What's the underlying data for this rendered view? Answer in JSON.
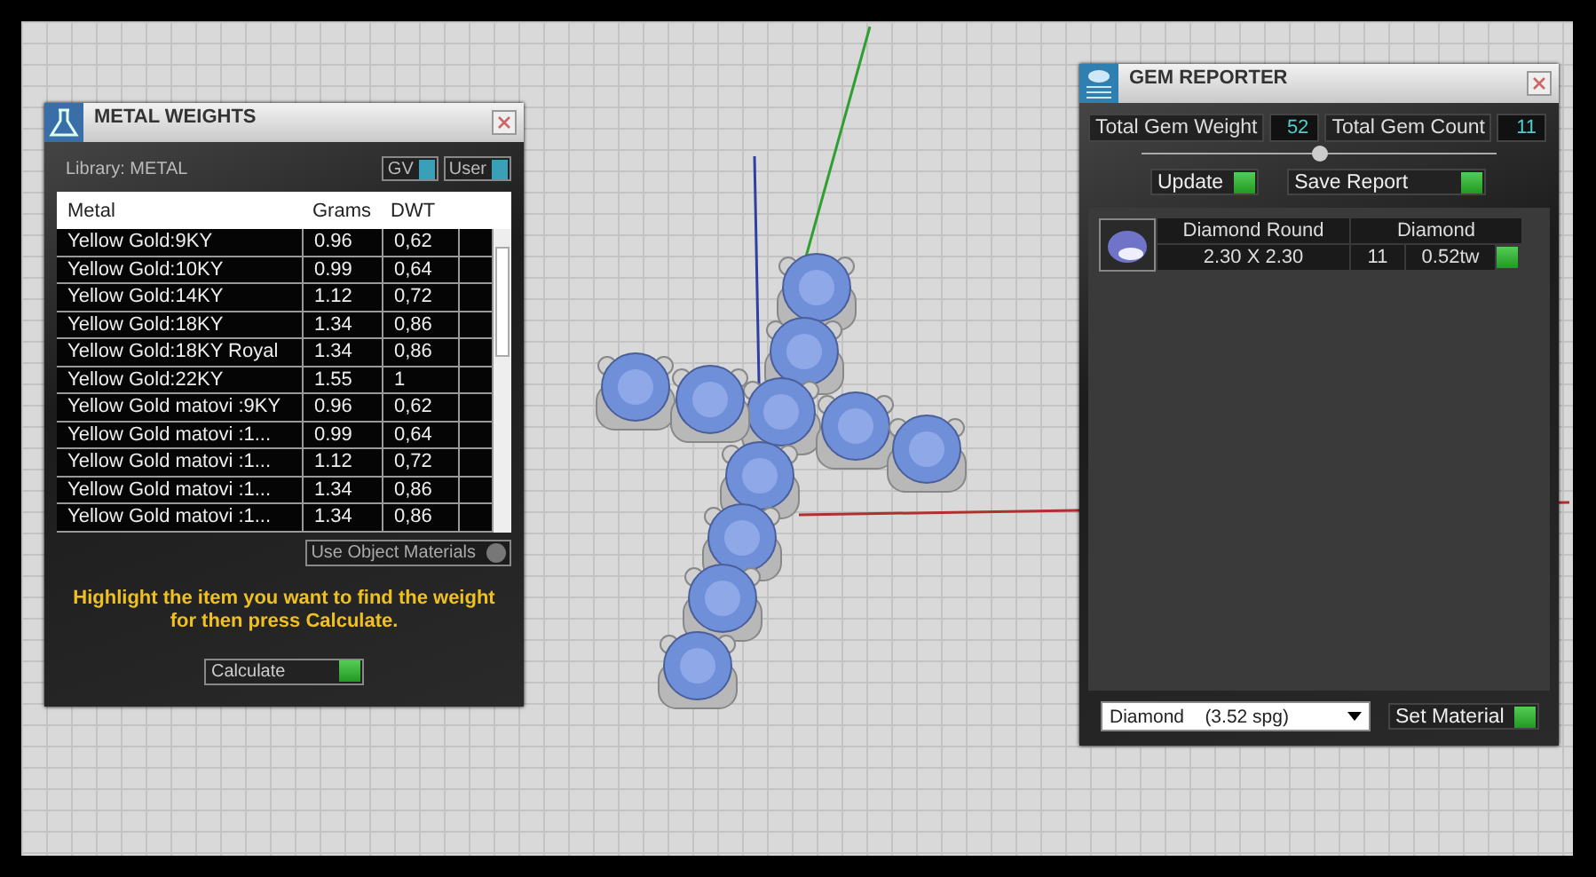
{
  "metal_weights": {
    "title": "METAL WEIGHTS",
    "library_label": "Library: METAL",
    "toggles": [
      {
        "label": "GV"
      },
      {
        "label": "User"
      }
    ],
    "columns": [
      "Metal",
      "Grams",
      "DWT"
    ],
    "rows": [
      {
        "metal": "Yellow Gold:9KY",
        "grams": "0.96",
        "dwt": "0,62"
      },
      {
        "metal": "Yellow Gold:10KY",
        "grams": "0.99",
        "dwt": "0,64"
      },
      {
        "metal": "Yellow Gold:14KY",
        "grams": "1.12",
        "dwt": "0,72"
      },
      {
        "metal": "Yellow Gold:18KY",
        "grams": "1.34",
        "dwt": "0,86"
      },
      {
        "metal": "Yellow Gold:18KY Royal",
        "grams": "1.34",
        "dwt": "0,86"
      },
      {
        "metal": "Yellow Gold:22KY",
        "grams": "1.55",
        "dwt": "1"
      },
      {
        "metal": "Yellow Gold matovi :9KY",
        "grams": "0.96",
        "dwt": "0,62"
      },
      {
        "metal": "Yellow Gold matovi :1...",
        "grams": "0.99",
        "dwt": "0,64"
      },
      {
        "metal": "Yellow Gold matovi :1...",
        "grams": "1.12",
        "dwt": "0,72"
      },
      {
        "metal": "Yellow Gold matovi :1...",
        "grams": "1.34",
        "dwt": "0,86"
      },
      {
        "metal": "Yellow Gold matovi :1...",
        "grams": "1.34",
        "dwt": "0,86"
      }
    ],
    "use_object_materials": "Use Object Materials",
    "hint": "Highlight the item you want to find the weight for then press Calculate.",
    "calculate": "Calculate"
  },
  "gem_reporter": {
    "title": "GEM REPORTER",
    "total_weight_label": "Total Gem Weight",
    "total_weight": "52",
    "total_count_label": "Total Gem Count",
    "total_count": "11",
    "update": "Update",
    "save_report": "Save Report",
    "gems": [
      {
        "shape": "Diamond Round",
        "size": "2.30 X 2.30",
        "material": "Diamond",
        "count": "11",
        "weight": "0.52tw"
      }
    ],
    "material_select": "Diamond    (3.52 spg)",
    "set_material": "Set Material"
  }
}
